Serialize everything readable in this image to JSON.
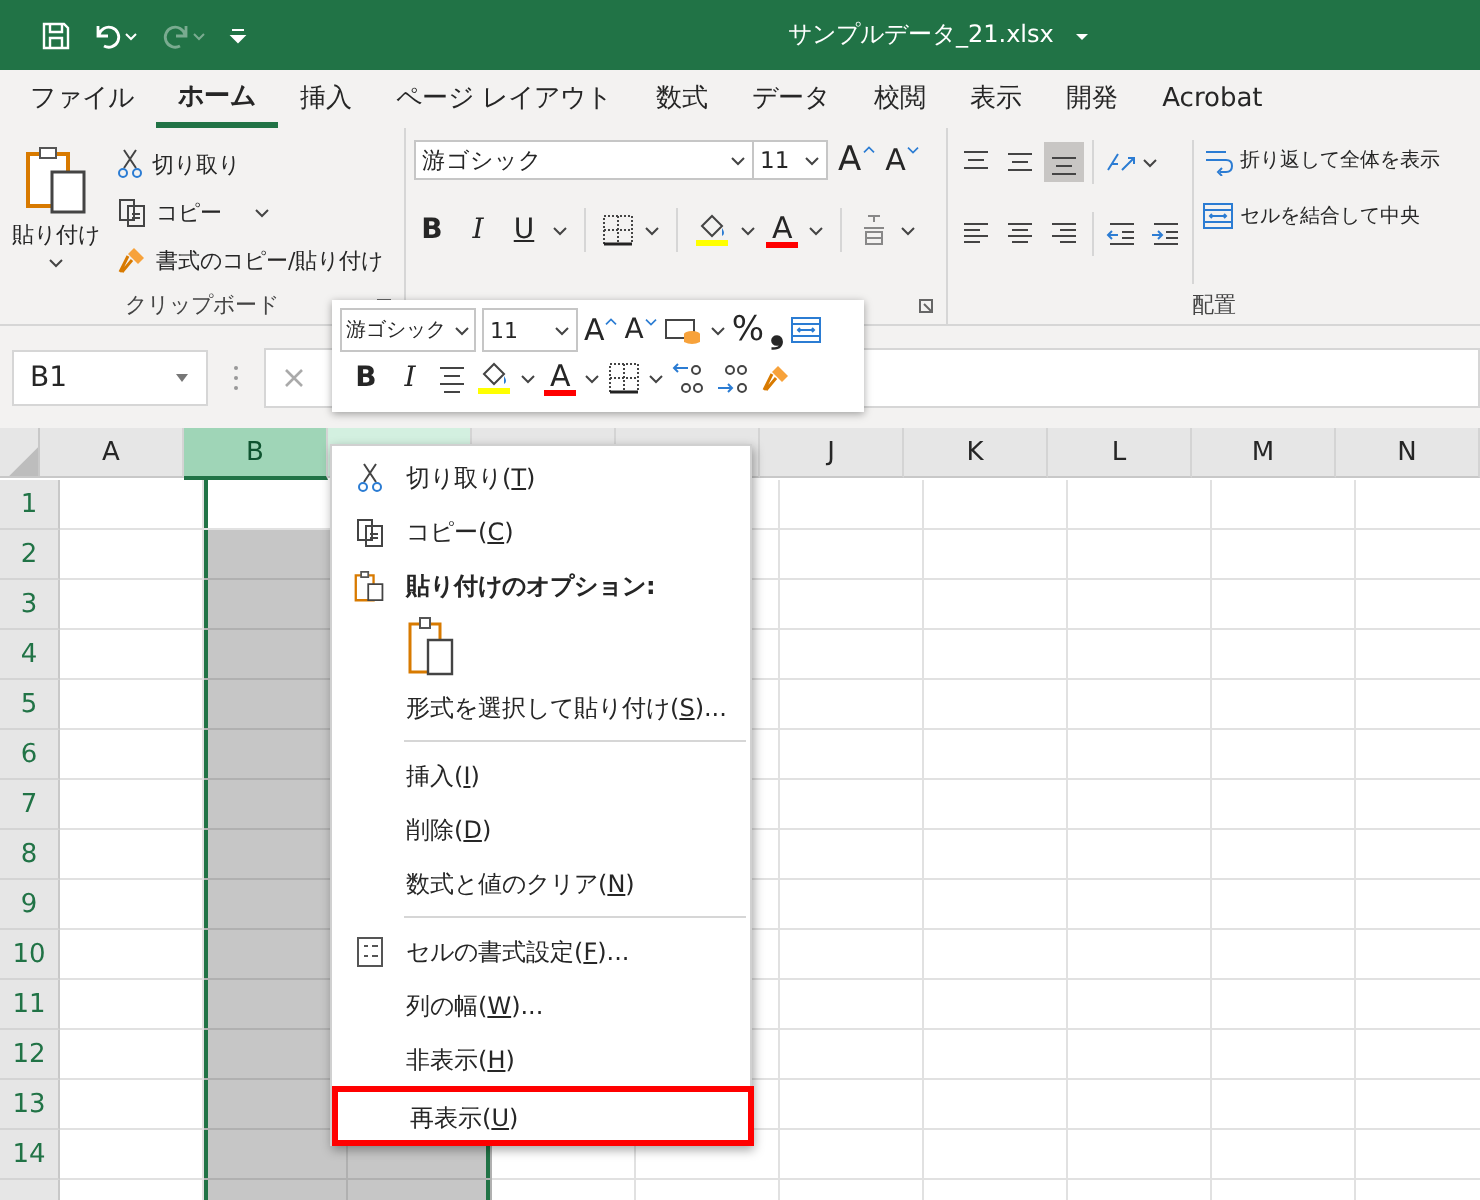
{
  "title_bar": {
    "title": "サンプルデータ_21.xlsx",
    "redo_disabled": true
  },
  "tabs": [
    {
      "label": "ファイル",
      "selected": false
    },
    {
      "label": "ホーム",
      "selected": true
    },
    {
      "label": "挿入",
      "selected": false
    },
    {
      "label": "ページ レイアウト",
      "selected": false
    },
    {
      "label": "数式",
      "selected": false
    },
    {
      "label": "データ",
      "selected": false
    },
    {
      "label": "校閲",
      "selected": false
    },
    {
      "label": "表示",
      "selected": false
    },
    {
      "label": "開発",
      "selected": false
    },
    {
      "label": "Acrobat",
      "selected": false
    }
  ],
  "ribbon": {
    "clipboard": {
      "paste": "貼り付け",
      "cut": "切り取り",
      "copy": "コピー",
      "format_painter": "書式のコピー/貼り付け",
      "label": "クリップボード"
    },
    "font": {
      "font_name": "游ゴシック",
      "font_size": "11",
      "grow": "A",
      "shrink": "A",
      "bold": "B",
      "italic": "I",
      "underline": "U",
      "font_color": "A"
    },
    "alignment": {
      "wrap_text": "折り返して全体を表示",
      "merge": "セルを結合して中央",
      "label": "配置"
    }
  },
  "formula_bar": {
    "name_box": "B1"
  },
  "columns": [
    {
      "label": "A",
      "selected": false,
      "active": false
    },
    {
      "label": "B",
      "selected": true,
      "active": true
    },
    {
      "selected": true,
      "active": false
    },
    {
      "selected": false,
      "active": false
    },
    {
      "selected": false,
      "active": false
    },
    {
      "label": "J",
      "selected": false,
      "active": false
    },
    {
      "label": "K",
      "selected": false,
      "active": false
    },
    {
      "label": "L",
      "selected": false,
      "active": false
    },
    {
      "label": "M",
      "selected": false,
      "active": false
    },
    {
      "label": "N",
      "selected": false,
      "active": false
    }
  ],
  "rows": [
    {
      "label": "1",
      "active": true
    },
    {
      "label": "2",
      "active": false
    },
    {
      "label": "3",
      "active": false
    },
    {
      "label": "4",
      "active": false
    },
    {
      "label": "5",
      "active": false
    },
    {
      "label": "6",
      "active": false
    },
    {
      "label": "7",
      "active": false
    },
    {
      "label": "8",
      "active": false
    },
    {
      "label": "9",
      "active": false
    },
    {
      "label": "10",
      "active": false
    },
    {
      "label": "11",
      "active": false
    },
    {
      "label": "12",
      "active": false
    },
    {
      "label": "13",
      "active": false
    },
    {
      "label": "14",
      "active": false
    }
  ],
  "mini_toolbar": {
    "font_name": "游ゴシック",
    "font_size": "11",
    "grow": "A",
    "shrink": "A",
    "percent": "%",
    "comma": "❟",
    "bold": "B",
    "italic": "I",
    "font_color": "A"
  },
  "context_menu": [
    {
      "kind": "cut",
      "before": "切り取り(",
      "key": "T",
      "after": ")",
      "highlighted": false
    },
    {
      "kind": "copy",
      "before": "コピー(",
      "key": "C",
      "after": ")",
      "highlighted": false
    },
    {
      "kind": "heading",
      "before": "貼り付けのオプション:"
    },
    {
      "kind": "paste-button"
    },
    {
      "kind": "command",
      "before": "形式を選択して貼り付け(",
      "key": "S",
      "after": ")...",
      "highlighted": false
    },
    {
      "kind": "separator"
    },
    {
      "kind": "command",
      "before": "挿入(",
      "key": "I",
      "after": ")",
      "highlighted": false
    },
    {
      "kind": "command",
      "before": "削除(",
      "key": "D",
      "after": ")",
      "highlighted": false
    },
    {
      "kind": "command",
      "before": "数式と値のクリア(",
      "key": "N",
      "after": ")",
      "highlighted": false
    },
    {
      "kind": "separator"
    },
    {
      "kind": "format-cells",
      "before": "セルの書式設定(",
      "key": "F",
      "after": ")...",
      "highlighted": false
    },
    {
      "kind": "command",
      "before": "列の幅(",
      "key": "W",
      "after": ")...",
      "highlighted": false
    },
    {
      "kind": "command",
      "before": "非表示(",
      "key": "H",
      "after": ")",
      "highlighted": false
    },
    {
      "kind": "command",
      "before": "再表示(",
      "key": "U",
      "after": ")",
      "highlighted": true
    }
  ]
}
